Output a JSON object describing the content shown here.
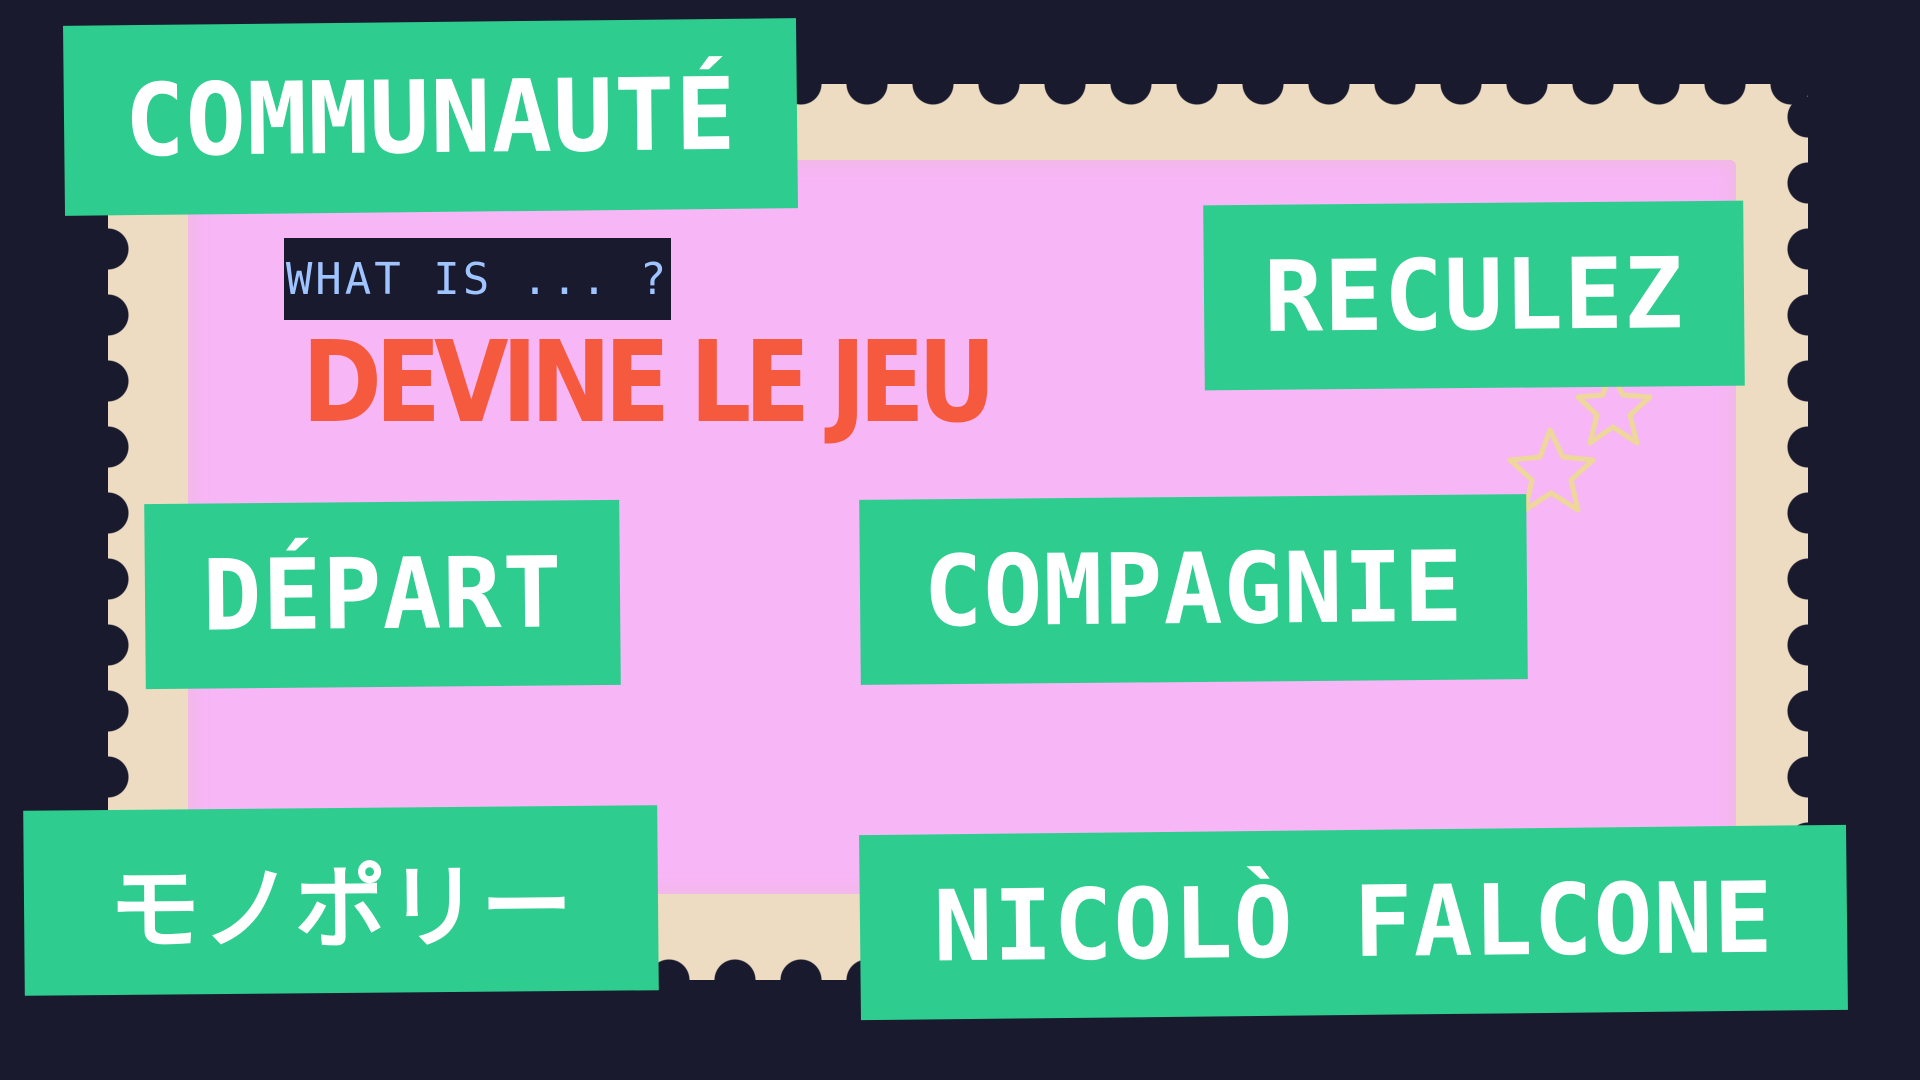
{
  "header": {
    "tag": "WHAT IS ... ?",
    "title": "DEVINE LE JEU"
  },
  "cards": [
    "COMMUNAUTÉ",
    "RECULEZ",
    "DÉPART",
    "COMPAGNIE",
    "モノポリー",
    "NICOLÒ FALCONE"
  ],
  "icons": {
    "decoration": "stars-icon"
  },
  "colors": {
    "background": "#191a2e",
    "stamp_border": "#eddcc2",
    "stamp_fill": "#f7b6f6",
    "card": "#2ecc8f",
    "card_text": "#ffffff",
    "title": "#f65a3e",
    "tag_text": "#9fc4ff"
  }
}
